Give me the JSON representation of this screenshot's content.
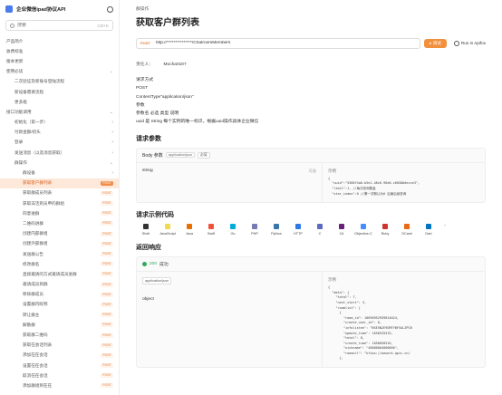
{
  "sidebar": {
    "app_name": "企业微信ipad协议API",
    "search_placeholder": "搜索",
    "search_shortcut": "Ctrl+K",
    "items": [
      {
        "label": "产品简介",
        "indent": 0
      },
      {
        "label": "收费标准",
        "indent": 0
      },
      {
        "label": "版本更新",
        "indent": 0
      },
      {
        "label": "使用必读",
        "indent": 0,
        "chev": "⌄"
      },
      {
        "label": "二次验证及新账号登陆流程",
        "indent": 1
      },
      {
        "label": "新设备需要流程",
        "indent": 1
      },
      {
        "label": "更多能",
        "indent": 1
      },
      {
        "label": "接口功能调用",
        "indent": 0,
        "chev": "⌄"
      },
      {
        "label": "初始化（第一步）",
        "indent": 1,
        "chev": "›"
      },
      {
        "label": "付款金额/初头",
        "indent": 1,
        "chev": "›"
      },
      {
        "label": "登录",
        "indent": 1,
        "chev": "›"
      },
      {
        "label": "发送消息（以及消息获取）",
        "indent": 1,
        "chev": "›"
      },
      {
        "label": "群操作",
        "indent": 1,
        "chev": "⌄"
      },
      {
        "label": "群设备",
        "indent": 2,
        "chev": "›"
      },
      {
        "label": "获取客户群列表",
        "indent": 2,
        "badge": "POST",
        "active": true
      },
      {
        "label": "获取群成员列表",
        "indent": 2,
        "badge": "POST"
      },
      {
        "label": "获取非活到员申的群组",
        "indent": 2,
        "badge": "POST"
      },
      {
        "label": "同意进群",
        "indent": 2,
        "badge": "POST"
      },
      {
        "label": "二维码进群",
        "indent": 2,
        "badge": "POST"
      },
      {
        "label": "创建内部群组",
        "indent": 2,
        "badge": "POST"
      },
      {
        "label": "创建外部群组",
        "indent": 2,
        "badge": "POST"
      },
      {
        "label": "发送群公告",
        "indent": 2,
        "badge": "POST"
      },
      {
        "label": "修改群名",
        "indent": 2,
        "badge": "POST"
      },
      {
        "label": "直接邀请的方式邀请成员进群",
        "indent": 2,
        "badge": "POST"
      },
      {
        "label": "邀请成员到群",
        "indent": 2,
        "badge": "POST"
      },
      {
        "label": "移除群成员",
        "indent": 2,
        "badge": "POST"
      },
      {
        "label": "设置群内昵称",
        "indent": 2,
        "badge": "POST"
      },
      {
        "label": "转让群主",
        "indent": 2,
        "badge": "POST"
      },
      {
        "label": "解散群",
        "indent": 2,
        "badge": "POST"
      },
      {
        "label": "获取群二维码",
        "indent": 2,
        "badge": "POST"
      },
      {
        "label": "获取在会话列表",
        "indent": 2,
        "badge": "POST"
      },
      {
        "label": "添加在在会话",
        "indent": 2,
        "badge": "POST"
      },
      {
        "label": "设置在在会话",
        "indent": 2,
        "badge": "POST"
      },
      {
        "label": "取消在在会话",
        "indent": 2,
        "badge": "POST"
      },
      {
        "label": "添加群组到在在",
        "indent": 2,
        "badge": "POST"
      }
    ]
  },
  "main": {
    "breadcrumb": "群操作",
    "title": "获取客户群列表",
    "method": "POST",
    "url": "http://***************/ChatroomMembers",
    "send_label": "▸ 调试",
    "apifox_label": "Run in Apifox",
    "owner_label": "责任人：",
    "owner_name": "Mocha0107",
    "desc_lines": [
      "请求方式",
      "POST",
      "ContentType\"application/json\"",
      "参数",
      "参数名 必选 类型 说明",
      "uuid 是 String 每个实例的唯一标识，根据uuid操作具体企业微信"
    ],
    "req_section": "请求参数",
    "body_label": "Body 参数",
    "body_tag1": "application/json",
    "body_tag2": "必填",
    "field_name": "string",
    "field_req": "可选",
    "example_label": "示例",
    "req_json_lines": [
      "{",
      "  \"uuid\":\"5368f4a0-b5e1-48c6-96e0-c6058b0ecce3\",",
      "  \"limit\":1, //每次查询数量",
      "  \"star_index\":0 //第一次默认为0 后面后续查询"
    ],
    "code_section": "请求示例代码",
    "languages": [
      {
        "name": "Shell",
        "color": "#333333"
      },
      {
        "name": "JavaScript",
        "color": "#f0db4f"
      },
      {
        "name": "Java",
        "color": "#e76f00"
      },
      {
        "name": "Swift",
        "color": "#f05138"
      },
      {
        "name": "Go",
        "color": "#00add8"
      },
      {
        "name": "PHP",
        "color": "#777bb3"
      },
      {
        "name": "Python",
        "color": "#3776ab"
      },
      {
        "name": "HTTP",
        "color": "#2c7be5"
      },
      {
        "name": "C",
        "color": "#5c6bc0"
      },
      {
        "name": "C#",
        "color": "#68217a"
      },
      {
        "name": "Objective-C",
        "color": "#438eff"
      },
      {
        "name": "Ruby",
        "color": "#cc342d"
      },
      {
        "name": "OCaml",
        "color": "#ec6813"
      },
      {
        "name": "Dart",
        "color": "#0175c2"
      }
    ],
    "more_label": "›",
    "resp_section": "返回响应",
    "status_code": "200",
    "status_text": "成功",
    "resp_content_type": "application/json",
    "resp_type": "object",
    "resp_example_label": "示例",
    "resp_json_lines": [
      "{",
      "  \"data\": {",
      "    \"total\": 7,",
      "    \"next_start\": 3,",
      "    \"roomlist\": [",
      "      {",
      "        \"room_id\": 10696952959814024,",
      "        \"create_user_id\": 0,",
      "        \"infolisten\": \"BSE5N2E9GMTYBFVALZPCB",
      "        \"update_time\": 1658535519,",
      "        \"total\": 8,",
      "        \"create_time\": 1658050516,",
      "        \"nickname\": \"48800004000000\",",
      "        \"roomurl\": \"https://wework.qpic.cn/",
      "      },"
    ]
  }
}
